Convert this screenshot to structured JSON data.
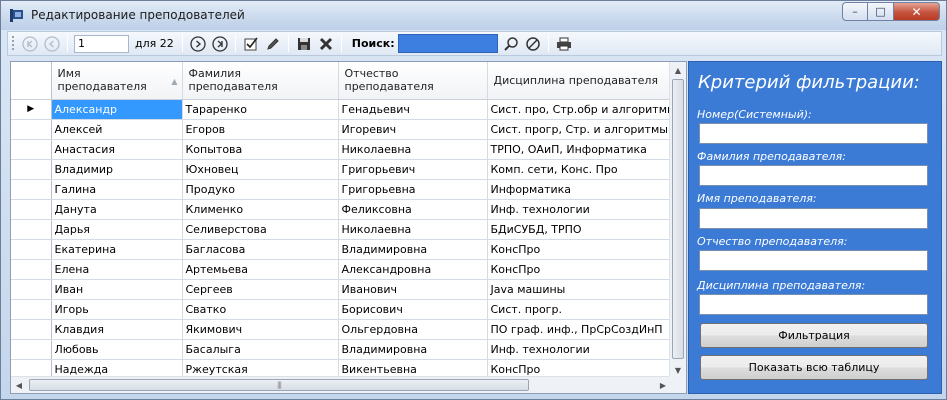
{
  "window": {
    "title": "Редактирование преподователей",
    "minimize": "–",
    "maximize": "□",
    "close": "✕"
  },
  "toolbar": {
    "position_value": "1",
    "total_label": "для 22",
    "search_label": "Поиск:",
    "search_value": ""
  },
  "grid": {
    "columns": [
      {
        "label": "Имя\nпреподавателя"
      },
      {
        "label": "Фамилия\nпреподавателя"
      },
      {
        "label": "Отчество\nпреподавателя"
      },
      {
        "label": "Дисциплина преподавателя"
      }
    ],
    "rows": [
      [
        "Александр",
        "Тараренко",
        "Генадьевич",
        "Сист. про, Стр.обр и алгоритмы"
      ],
      [
        "Алексей",
        "Егоров",
        "Игоревич",
        "Сист. прогр, Стр. и алгоритмы с"
      ],
      [
        "Анастасия",
        "Копытова",
        "Николаевна",
        "ТРПО, ОАиП, Информатика"
      ],
      [
        "Владимир",
        "Юхновец",
        "Григорьевич",
        "Комп. сети, Конс. Про"
      ],
      [
        "Галина",
        "Продуко",
        "Григорьевна",
        "Информатика"
      ],
      [
        "Данута",
        "Клименко",
        "Феликсовна",
        "Инф. технологии"
      ],
      [
        "Дарья",
        "Селиверстова",
        "Николаевна",
        "БДиСУБД, ТРПО"
      ],
      [
        "Екатерина",
        "Багласова",
        "Владимировна",
        "КонсПро"
      ],
      [
        "Елена",
        "Артемьева",
        "Александровна",
        "КонсПро"
      ],
      [
        "Иван",
        "Сергеев",
        "Иванович",
        "Java машины"
      ],
      [
        "Игорь",
        "Сватко",
        "Борисович",
        "Сист. прогр."
      ],
      [
        "Клавдия",
        "Якимович",
        "Ольгердовна",
        "ПО граф. инф., ПрСрСоздИнП"
      ],
      [
        "Любовь",
        "Басалыга",
        "Владимировна",
        "Инф. технологии"
      ],
      [
        "Надежда",
        "Ржеутская",
        "Викентьевна",
        "КонсПро"
      ]
    ],
    "selected_row": 0,
    "row_indicator": "▶",
    "hscroll_grip": "|||"
  },
  "filter_panel": {
    "title": "Критерий фильтрации:",
    "fields": [
      {
        "label": "Номер(Системный):",
        "value": ""
      },
      {
        "label": "Фамилия преподавателя:",
        "value": ""
      },
      {
        "label": "Имя преподавателя:",
        "value": ""
      },
      {
        "label": "Отчество преподавателя:",
        "value": ""
      },
      {
        "label": "Дисциплина преподавателя:",
        "value": ""
      }
    ],
    "filter_button": "Фильтрация",
    "show_all_button": "Показать всю таблицу"
  },
  "colors": {
    "panel_bg": "#3b7bd6",
    "selection": "#3399ff",
    "search_box": "#3d7fe0"
  }
}
